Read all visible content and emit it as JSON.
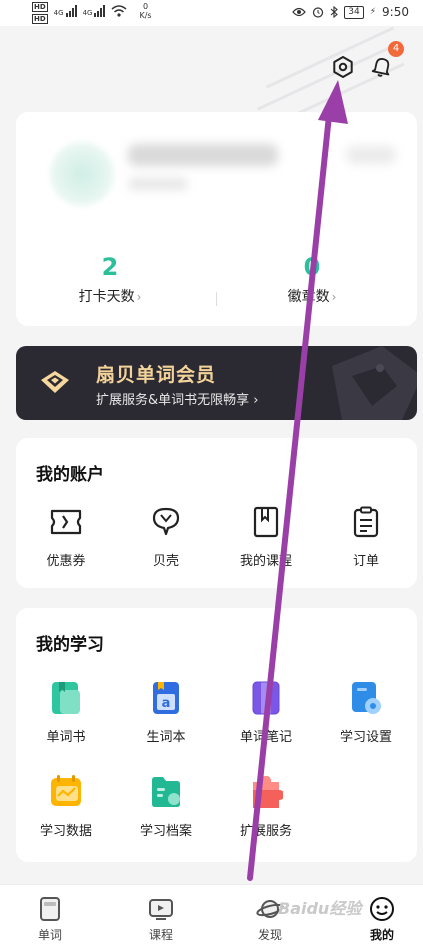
{
  "status_bar": {
    "hd_labels": [
      "HD",
      "HD"
    ],
    "net_type_1": "4G",
    "net_type_2": "4G",
    "net_speed_value": "0",
    "net_speed_unit": "K/s",
    "battery": "34",
    "time": "9:50"
  },
  "header": {
    "notification_count": "4",
    "icons": [
      "settings-gear-icon",
      "notification-bell-icon"
    ]
  },
  "profile": {
    "stats": [
      {
        "value": "2",
        "label": "打卡天数",
        "chevron": "›"
      },
      {
        "value": "0",
        "label": "徽章数",
        "chevron": "›"
      }
    ]
  },
  "vip": {
    "title": "扇贝单词会员",
    "subtitle": "扩展服务&单词书无限畅享 ›",
    "colors": {
      "background": "#2b2a33",
      "title": "#f3d39a"
    }
  },
  "account": {
    "title": "我的账户",
    "items": [
      {
        "label": "优惠券",
        "icon": "coupon-icon"
      },
      {
        "label": "贝壳",
        "icon": "shell-icon"
      },
      {
        "label": "我的课程",
        "icon": "course-book-icon"
      },
      {
        "label": "订单",
        "icon": "order-clipboard-icon"
      }
    ]
  },
  "study": {
    "title": "我的学习",
    "items": [
      {
        "label": "单词书",
        "icon": "word-book-icon"
      },
      {
        "label": "生词本",
        "icon": "new-words-notebook-icon"
      },
      {
        "label": "单词笔记",
        "icon": "word-notes-icon"
      },
      {
        "label": "学习设置",
        "icon": "study-settings-icon"
      },
      {
        "label": "学习数据",
        "icon": "study-data-icon"
      },
      {
        "label": "学习档案",
        "icon": "study-archive-icon"
      },
      {
        "label": "扩展服务",
        "icon": "extension-puzzle-icon"
      }
    ]
  },
  "bottom_nav": {
    "items": [
      {
        "label": "单词",
        "icon": "word-card-icon",
        "active": false
      },
      {
        "label": "课程",
        "icon": "course-play-icon",
        "active": false
      },
      {
        "label": "发现",
        "icon": "planet-icon",
        "active": false
      },
      {
        "label": "我的",
        "icon": "smiley-face-icon",
        "active": true
      }
    ]
  },
  "watermark": "Baidu经验",
  "theme": {
    "accent": "#2bbf9a",
    "badge": "#f26a3c",
    "annotation_arrow": "#9b3fa8"
  }
}
